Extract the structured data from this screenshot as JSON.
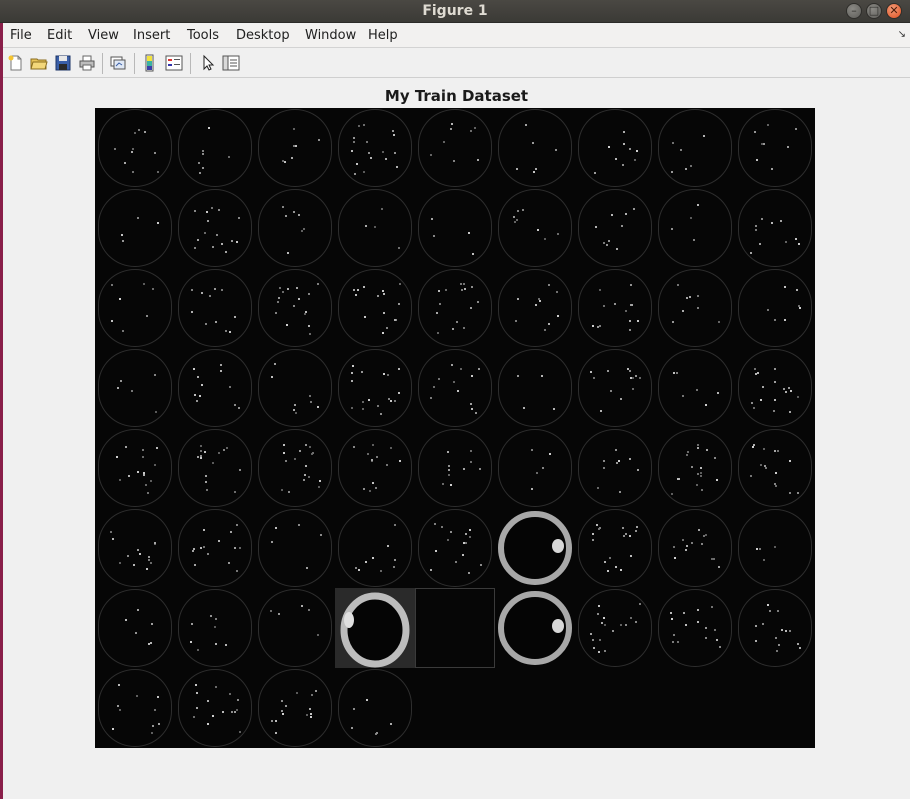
{
  "window": {
    "title": "Figure 1",
    "controls": [
      "minimize",
      "maximize",
      "close"
    ]
  },
  "menubar": {
    "items": [
      {
        "label": "File",
        "mnemonic": "F"
      },
      {
        "label": "Edit",
        "mnemonic": "E"
      },
      {
        "label": "View",
        "mnemonic": "V"
      },
      {
        "label": "Insert",
        "mnemonic": "I"
      },
      {
        "label": "Tools",
        "mnemonic": "T"
      },
      {
        "label": "Desktop",
        "mnemonic": "D"
      },
      {
        "label": "Window",
        "mnemonic": "W"
      },
      {
        "label": "Help",
        "mnemonic": "H"
      }
    ]
  },
  "toolbar": {
    "icons": [
      "new-figure-icon",
      "open-file-icon",
      "save-icon",
      "print-icon",
      "link-plot-icon",
      "colorbar-icon",
      "legend-icon",
      "pointer-icon",
      "property-editor-icon"
    ]
  },
  "figure": {
    "title": "My Train Dataset",
    "montage": {
      "columns": 9,
      "rows": 8,
      "tile_count": 67,
      "background_color": "#060606"
    }
  }
}
